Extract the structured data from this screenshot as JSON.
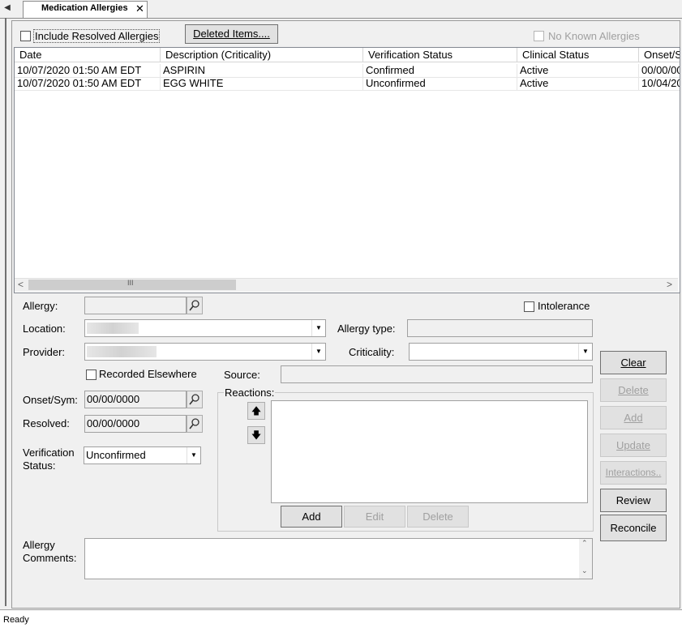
{
  "tab": {
    "label": "Medication Allergies",
    "close": "✕",
    "nav": "◀"
  },
  "toolbar": {
    "include_resolved": "Include Resolved Allergies",
    "deleted_items": "Deleted Items....",
    "no_known": "No Known Allergies"
  },
  "grid": {
    "columns": [
      "Date",
      "Description (Criticality)",
      "Verification Status",
      "Clinical Status",
      "Onset/S"
    ],
    "rows": [
      [
        "10/07/2020 01:50 AM EDT",
        "ASPIRIN",
        "Confirmed",
        "Active",
        "00/00/00"
      ],
      [
        "10/07/2020 01:50 AM EDT",
        "EGG WHITE",
        "Unconfirmed",
        "Active",
        "10/04/20"
      ]
    ],
    "scroll_grip": "III"
  },
  "form": {
    "allergy_label": "Allergy:",
    "location_label": "Location:",
    "provider_label": "Provider:",
    "recorded_elsewhere": "Recorded Elsewhere",
    "onset_label": "Onset/Sym:",
    "onset_value": "00/00/0000",
    "resolved_label": "Resolved:",
    "resolved_value": "00/00/0000",
    "verification_label_1": "Verification",
    "verification_label_2": "Status:",
    "verification_value": "Unconfirmed",
    "intolerance": "Intolerance",
    "allergy_type_label": "Allergy type:",
    "criticality_label": "Criticality:",
    "source_label": "Source:",
    "reactions_label": "Reactions:",
    "comments_label_1": "Allergy",
    "comments_label_2": "Comments:"
  },
  "reactions": {
    "add": "Add",
    "edit": "Edit",
    "delete": "Delete",
    "up": "🡅",
    "down": "🡇"
  },
  "actions": {
    "clear": "Clear",
    "delete": "Delete",
    "add": "Add",
    "update": "Update",
    "interactions": "Interactions..",
    "review": "Review",
    "reconcile": "Reconcile"
  },
  "status_bar": "Ready"
}
